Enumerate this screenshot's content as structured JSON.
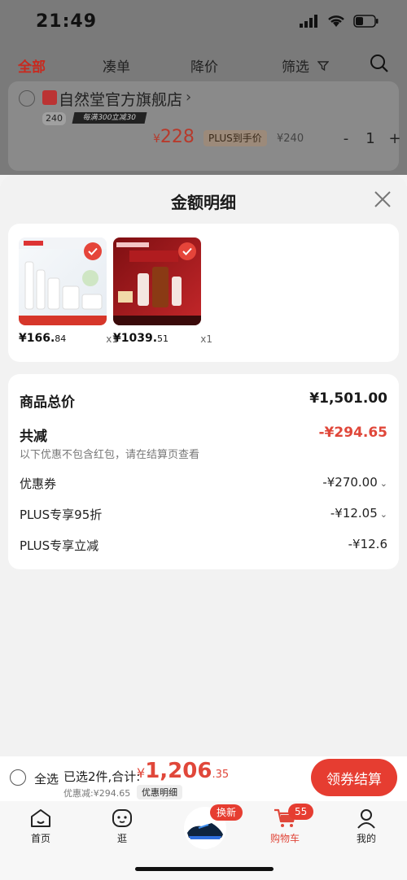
{
  "status_bar": {
    "time": "21:49"
  },
  "cart_tabs": [
    {
      "label": "全部",
      "active": true
    },
    {
      "label": "凑单",
      "active": false
    },
    {
      "label": "降价",
      "active": false
    },
    {
      "label": "筛选",
      "active": false
    }
  ],
  "store": {
    "name": "自然堂官方旗舰店",
    "chevron": "›",
    "promo_badge": "240",
    "promo_strip": "每满300立减30",
    "item_price_currency": "¥",
    "item_price": "228",
    "plus_tag": "PLUS到手价",
    "orig_price": "¥240",
    "qty": "1",
    "minus": "-",
    "plus": "+"
  },
  "sheet": {
    "title": "金额明细",
    "products": [
      {
        "price_int": "¥166.",
        "price_dec": "84",
        "qty": "x1"
      },
      {
        "price_int": "¥1039.",
        "price_dec": "51",
        "qty": "x1"
      }
    ],
    "summary": {
      "goods_total_label": "商品总价",
      "goods_total_value": "¥1,501.00",
      "reduction_label": "共减",
      "reduction_value": "-¥294.65",
      "reduction_note": "以下优惠不包含红包，请在结算页查看",
      "coupon_label": "优惠券",
      "coupon_value": "-¥270.00",
      "plus_discount_label": "PLUS专享95折",
      "plus_discount_value": "-¥12.05",
      "plus_reduce_label": "PLUS专享立减",
      "plus_reduce_value": "-¥12.6"
    }
  },
  "bottom_bar": {
    "select_all": "全选",
    "selected_text": "已选2件,合计:",
    "total_currency": "¥",
    "total_int": "1,206",
    "total_dec": ".35",
    "discount_text": "优惠减:¥294.65",
    "detail_pill": "优惠明细",
    "checkout": "领券结算"
  },
  "tab_bar": {
    "home": "首页",
    "browse": "逛",
    "swap_badge": "换新",
    "cart": "购物车",
    "cart_badge": "55",
    "me": "我的"
  },
  "colors": {
    "accent": "#e63d31",
    "price_red": "#e0473a"
  }
}
